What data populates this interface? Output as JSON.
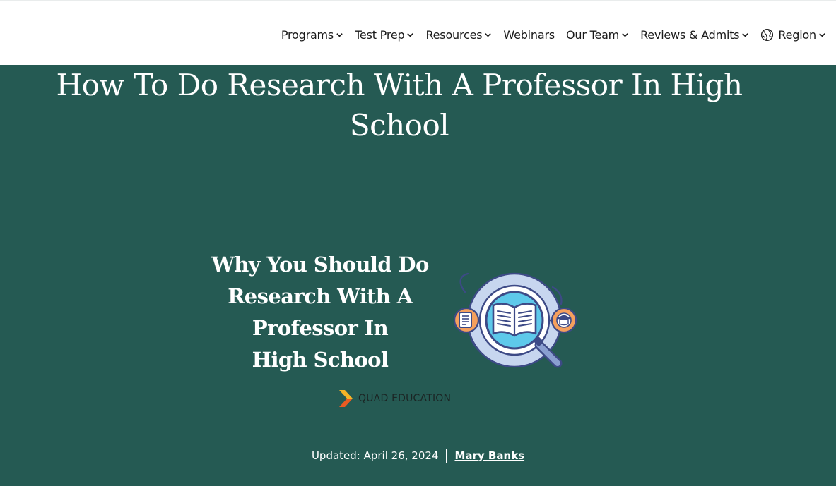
{
  "nav": {
    "items": [
      {
        "label": "Programs",
        "dropdown": true
      },
      {
        "label": "Test Prep",
        "dropdown": true
      },
      {
        "label": "Resources",
        "dropdown": true
      },
      {
        "label": "Webinars",
        "dropdown": false
      },
      {
        "label": "Our Team",
        "dropdown": true
      },
      {
        "label": "Reviews & Admits",
        "dropdown": true
      }
    ],
    "region": {
      "label": "Region",
      "icon": "globe-icon",
      "dropdown": true
    }
  },
  "article": {
    "title": "How To Do Research With A Professor In High School",
    "updated_label": "Updated: April 26, 2024",
    "author": "Mary Banks"
  },
  "banner": {
    "heading_lines": [
      "Why You Should Do",
      "Research With A",
      "Professor In",
      "High School"
    ],
    "brand_name": "QUAD EDUCATION",
    "icons": [
      "document-icon",
      "open-book-icon",
      "magnifying-glass-icon",
      "graduation-cap-icon",
      "quad-logo-icon"
    ]
  },
  "colors": {
    "hero_background": "#255a53",
    "nav_text": "#1a1a1a",
    "illustration_blue": "#c7d6ef",
    "illustration_cyan": "#5ec9ea",
    "illustration_orange": "#f5a05d",
    "outline": "#3d4a86"
  }
}
